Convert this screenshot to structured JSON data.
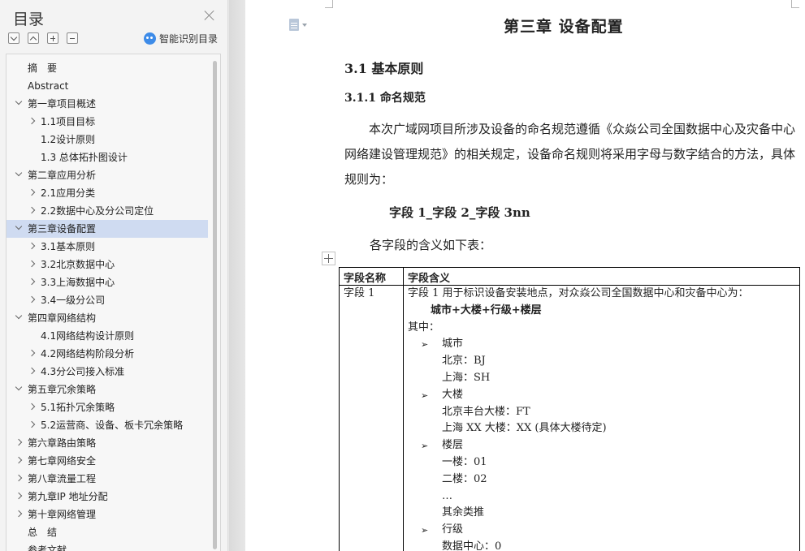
{
  "sidebar": {
    "title": "目录",
    "smart_toc_label": "智能识别目录",
    "items": [
      {
        "label": "摘　要",
        "level": 0,
        "expander": "none",
        "active": false
      },
      {
        "label": "Abstract",
        "level": 0,
        "expander": "none",
        "active": false
      },
      {
        "label": "第一章项目概述",
        "level": 0,
        "expander": "expanded",
        "active": false
      },
      {
        "label": "1.1项目目标",
        "level": 1,
        "expander": "collapsed",
        "active": false
      },
      {
        "label": "1.2设计原则",
        "level": 1,
        "expander": "none",
        "active": false
      },
      {
        "label": "1.3 总体拓扑图设计",
        "level": 1,
        "expander": "none",
        "active": false
      },
      {
        "label": "第二章应用分析",
        "level": 0,
        "expander": "expanded",
        "active": false
      },
      {
        "label": "2.1应用分类",
        "level": 1,
        "expander": "collapsed",
        "active": false
      },
      {
        "label": "2.2数据中心及分公司定位",
        "level": 1,
        "expander": "collapsed",
        "active": false
      },
      {
        "label": "第三章设备配置",
        "level": 0,
        "expander": "expanded",
        "active": true
      },
      {
        "label": "3.1基本原则",
        "level": 1,
        "expander": "collapsed",
        "active": false
      },
      {
        "label": "3.2北京数据中心",
        "level": 1,
        "expander": "collapsed",
        "active": false
      },
      {
        "label": "3.3上海数据中心",
        "level": 1,
        "expander": "collapsed",
        "active": false
      },
      {
        "label": "3.4一级分公司",
        "level": 1,
        "expander": "collapsed",
        "active": false
      },
      {
        "label": "第四章网络结构",
        "level": 0,
        "expander": "expanded",
        "active": false
      },
      {
        "label": "4.1网络结构设计原则",
        "level": 1,
        "expander": "none",
        "active": false
      },
      {
        "label": "4.2网络结构阶段分析",
        "level": 1,
        "expander": "collapsed",
        "active": false
      },
      {
        "label": "4.3分公司接入标准",
        "level": 1,
        "expander": "collapsed",
        "active": false
      },
      {
        "label": "第五章冗余策略",
        "level": 0,
        "expander": "expanded",
        "active": false
      },
      {
        "label": "5.1拓扑冗余策略",
        "level": 1,
        "expander": "collapsed",
        "active": false
      },
      {
        "label": "5.2运营商、设备、板卡冗余策略",
        "level": 1,
        "expander": "collapsed",
        "active": false
      },
      {
        "label": "第六章路由策略",
        "level": 0,
        "expander": "collapsed",
        "active": false
      },
      {
        "label": "第七章网络安全",
        "level": 0,
        "expander": "collapsed",
        "active": false
      },
      {
        "label": "第八章流量工程",
        "level": 0,
        "expander": "collapsed",
        "active": false
      },
      {
        "label": "第九章IP 地址分配",
        "level": 0,
        "expander": "collapsed",
        "active": false
      },
      {
        "label": "第十章网络管理",
        "level": 0,
        "expander": "collapsed",
        "active": false
      },
      {
        "label": "总　结",
        "level": 0,
        "expander": "none",
        "active": false
      },
      {
        "label": "参考文献",
        "level": 0,
        "expander": "none",
        "active": false
      }
    ]
  },
  "document": {
    "chapter_title": "第三章  设备配置",
    "section_title": "3.1  基本原则",
    "subsection_title": "3.1.1  命名规范",
    "paragraph": "本次广域网项目所涉及设备的命名规范遵循《众焱公司全国数据中心及灾备中心网络建设管理规范》的相关规定，设备命名规则将采用字母与数字结合的方法，具体规则为：",
    "formula": "字段 1_字段 2_字段 3nn",
    "paragraph2": "各字段的含义如下表：",
    "table": {
      "header_name": "字段名称",
      "header_meaning": "字段含义",
      "row1_name": "字段 1",
      "row1_lines": [
        "字段 1 用于标识设备安装地点，对众焱公司全国数据中心和灾备中心为：",
        "城市+大楼+行级+楼层",
        "其中：",
        "城市",
        "北京：BJ",
        "上海：SH",
        "大楼",
        "北京丰台大楼：FT",
        "上海 XX 大楼：XX (具体大楼待定)",
        "楼层",
        "一楼：01",
        "二楼：02",
        "…",
        "其余类推",
        "行级",
        "数据中心：0"
      ],
      "bullet_glyph": "➢"
    }
  }
}
